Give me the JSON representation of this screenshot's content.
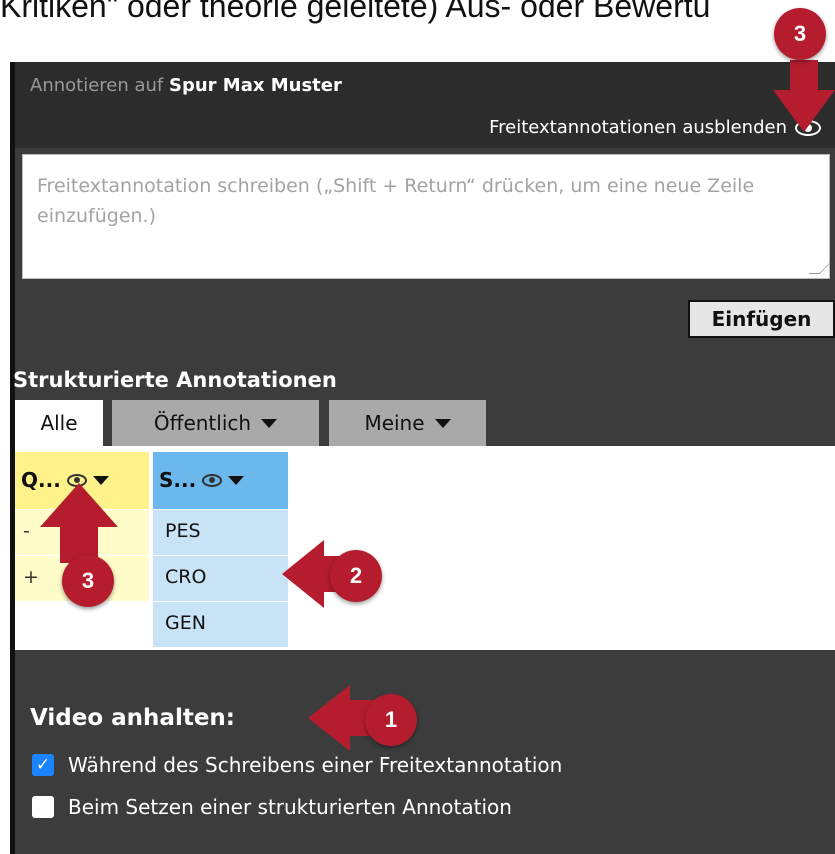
{
  "caption": {
    "text": "Kritiken\" oder theorie geleitete) Aus- oder Bewertu"
  },
  "header": {
    "prefix": "Annotieren auf",
    "track_name": "Spur Max Muster",
    "hide_freetext_label": "Freitextannotationen ausblenden"
  },
  "editor": {
    "placeholder": "Freitextannotation schreiben („Shift + Return“ drücken, um eine neue Zeile einzufügen.)",
    "insert_label": "Einfügen"
  },
  "structured": {
    "title": "Strukturierte Annotationen",
    "tabs": [
      {
        "label": "Alle",
        "active": true
      },
      {
        "label": "Öffentlich",
        "active": false
      },
      {
        "label": "Meine",
        "active": false
      }
    ],
    "columns": [
      {
        "header": "Q...",
        "cells": [
          "-",
          "+"
        ]
      },
      {
        "header": "S...",
        "cells": [
          "PES",
          "CRO",
          "GEN"
        ]
      }
    ]
  },
  "pause": {
    "title": "Video anhalten:",
    "options": [
      {
        "label": "Während des Schreibens einer Freitextannotation",
        "checked": true
      },
      {
        "label": "Beim Setzen einer strukturierten Annotation",
        "checked": false
      }
    ]
  },
  "callouts": {
    "badges": [
      "3",
      "3",
      "2",
      "1"
    ],
    "color": "#b51d2e"
  },
  "colors": {
    "panel": "#3c3c3c",
    "q_column": "#fff28a",
    "s_column": "#6cb7ec",
    "checkbox_on": "#1a84ff"
  }
}
